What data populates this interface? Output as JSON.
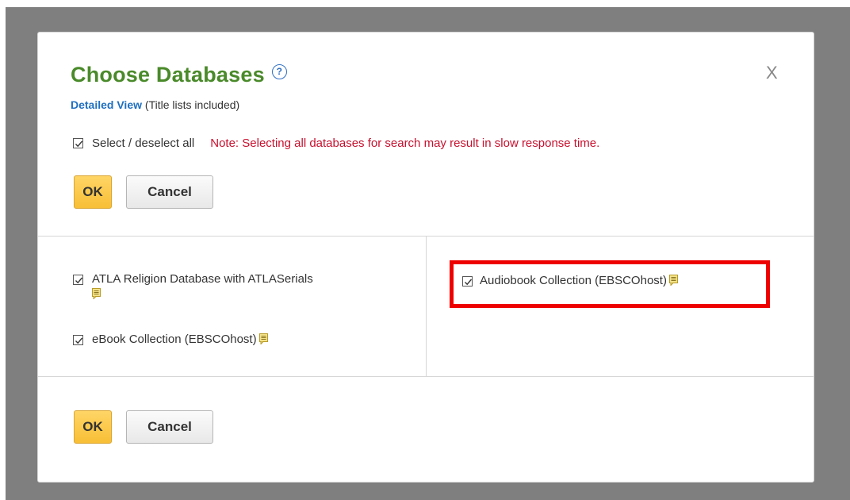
{
  "dialog": {
    "title": "Choose Databases",
    "help_icon": "?",
    "close_label": "X",
    "detailed_view_link": "Detailed View",
    "detailed_view_suffix": "(Title lists included)",
    "select_all": {
      "label": "Select / deselect all",
      "checked": true
    },
    "note": "Note: Selecting all databases for search may result in slow response time.",
    "buttons": {
      "ok_label": "OK",
      "cancel_label": "Cancel"
    },
    "databases": [
      {
        "name": "ATLA Religion Database with ATLASerials",
        "checked": true
      },
      {
        "name": "eBook Collection (EBSCOhost)",
        "checked": true
      },
      {
        "name": "Audiobook Collection (EBSCOhost)",
        "checked": true
      }
    ]
  },
  "colors": {
    "title": "#4a8a2a",
    "link": "#1f6fc0",
    "note": "#c8102e",
    "ok_button": "#f8bf36",
    "highlight_border": "#ee0000",
    "overlay": "#7f7f7f"
  },
  "icons": {
    "help": "question-circle-icon",
    "close": "close-icon",
    "checkbox": "checkmark-icon",
    "title_list_note": "note-icon"
  }
}
